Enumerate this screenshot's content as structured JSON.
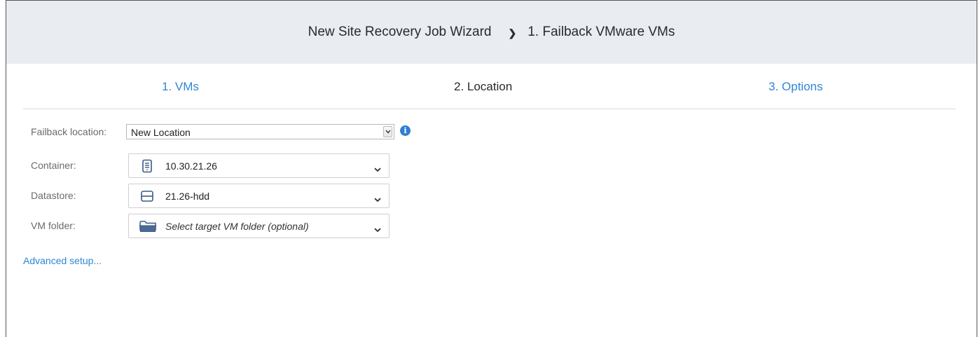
{
  "header": {
    "wizard_title": "New Site Recovery Job Wizard",
    "separator": "❯",
    "step_title": "1. Failback VMware VMs"
  },
  "steps": [
    {
      "label": "1. VMs",
      "state": "link"
    },
    {
      "label": "2. Location",
      "state": "current"
    },
    {
      "label": "3. Options",
      "state": "link"
    }
  ],
  "form": {
    "failback_location": {
      "label": "Failback location:",
      "value": "New Location"
    },
    "container": {
      "label": "Container:",
      "value": "10.30.21.26",
      "icon": "server-icon"
    },
    "datastore": {
      "label": "Datastore:",
      "value": "21.26-hdd",
      "icon": "datastore-icon"
    },
    "vm_folder": {
      "label": "VM folder:",
      "placeholder": "Select target VM folder (optional)",
      "icon": "folder-icon"
    }
  },
  "advanced_link": "Advanced setup...",
  "colors": {
    "header_bg": "#e9ecf1",
    "link": "#2f86d6",
    "icon": "#3b5a85",
    "info": "#2f7fd1"
  }
}
